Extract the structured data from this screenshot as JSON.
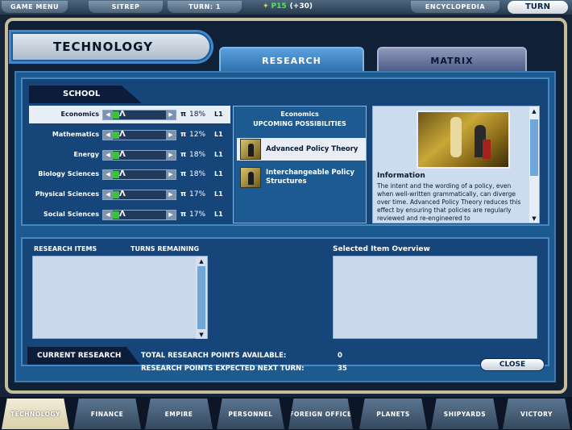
{
  "topbar": {
    "menu_items": [
      "GAME MENU",
      "SITREP",
      "TURN: 1"
    ],
    "money_amount": "P15",
    "money_delta": "(+30)",
    "encyclopedia_label": "ENCYCLOPEDIA",
    "turn_button": "TURN"
  },
  "page": {
    "title": "TECHNOLOGY",
    "tabs": {
      "research": "RESEARCH",
      "matrix": "MATRIX"
    }
  },
  "school": {
    "header": "SCHOOL",
    "rows": [
      {
        "label": "Economics",
        "percent": "18%",
        "level": "L1"
      },
      {
        "label": "Mathematics",
        "percent": "12%",
        "level": "L1"
      },
      {
        "label": "Energy",
        "percent": "18%",
        "level": "L1"
      },
      {
        "label": "Biology Sciences",
        "percent": "18%",
        "level": "L1"
      },
      {
        "label": "Physical Sciences",
        "percent": "17%",
        "level": "L1"
      },
      {
        "label": "Social Sciences",
        "percent": "17%",
        "level": "L1"
      }
    ]
  },
  "possibilities": {
    "heading_line1": "Economics",
    "heading_line2": "UPCOMING POSSIBILITIES",
    "items": [
      "Advanced Policy Theory",
      "Interchangeable Policy Structures"
    ]
  },
  "info": {
    "title": "Information",
    "text": "The intent and the wording of a policy, even when well-written grammatically, can diverge over time. Advanced Policy Theory reduces this effect by ensuring that policies are regularly reviewed and re-engineered to"
  },
  "lower": {
    "research_items_label": "RESEARCH ITEMS",
    "turns_remaining_label": "TURNS REMAINING",
    "overview_label": "Selected Item Overview",
    "current_research_label": "CURRENT RESEARCH",
    "rp_available_label": "TOTAL RESEARCH POINTS AVAILABLE:",
    "rp_available_value": "0",
    "rp_next_label": "RESEARCH POINTS EXPECTED NEXT TURN:",
    "rp_next_value": "35",
    "close_button": "CLOSE"
  },
  "bottom_nav": {
    "tabs": [
      "TECHNOLOGY",
      "FINANCE",
      "EMPIRE",
      "PERSONNEL",
      "FOREIGN OFFICE",
      "PLANETS",
      "SHIPYARDS",
      "VICTORY"
    ],
    "active": "TECHNOLOGY"
  },
  "colors": {
    "panel_blue": "#1d5a90",
    "frame_tan": "#c8bd9a",
    "slider_green": "#3bc23b"
  }
}
